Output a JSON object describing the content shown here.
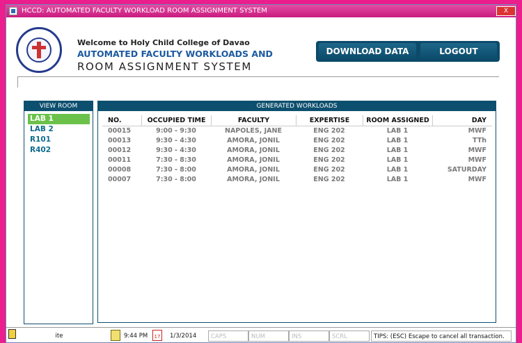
{
  "window": {
    "title": "HCCD: AUTOMATED FACULTY WORKLOAD  ROOM ASSIGNMENT SYSTEM",
    "close_label": "X"
  },
  "header": {
    "welcome": "Welcome to Holy Child College of Davao",
    "system_line1": "AUTOMATED FACULTY WORKLOADS AND",
    "system_line2": "ROOM  ASSIGNMENT  SYSTEM",
    "download_label": "DOWNLOAD DATA",
    "logout_label": "LOGOUT"
  },
  "view_room": {
    "title": "VIEW ROOM",
    "items": [
      {
        "label": "LAB 1",
        "selected": true
      },
      {
        "label": "LAB 2",
        "selected": false
      },
      {
        "label": "R101",
        "selected": false
      },
      {
        "label": "R402",
        "selected": false
      }
    ]
  },
  "workloads": {
    "title": "GENERATED WORKLOADS",
    "columns": [
      "NO.",
      "OCCUPIED TIME",
      "FACULTY",
      "EXPERTISE",
      "ROOM ASSIGNED",
      "DAY"
    ],
    "rows": [
      [
        "00015",
        "9:00 - 9:30",
        "NAPOLES, JANE",
        "ENG 202",
        "LAB 1",
        "MWF"
      ],
      [
        "00013",
        "9:30 - 4:30",
        "AMORA, JONIL",
        "ENG 202",
        "LAB 1",
        "TTh"
      ],
      [
        "00012",
        "9:30 - 4:30",
        "AMORA, JONIL",
        "ENG 202",
        "LAB 1",
        "MWF"
      ],
      [
        "00011",
        "7:30 - 8:30",
        "AMORA, JONIL",
        "ENG 202",
        "LAB 1",
        "MWF"
      ],
      [
        "00008",
        "7:30 - 8:00",
        "AMORA, JONIL",
        "ENG 202",
        "LAB 1",
        "SATURDAY"
      ],
      [
        "00007",
        "7:30 - 8:00",
        "AMORA, JONIL",
        "ENG 202",
        "LAB 1",
        "MWF"
      ]
    ]
  },
  "statusbar": {
    "user": "ite",
    "time": "9:44 PM",
    "calendar_day": "17",
    "date": "1/3/2014",
    "caps": "CAPS",
    "num": "NUM",
    "ins": "INS",
    "scrl": "SCRL",
    "tips": "TIPS: (ESC) Escape to cancel all transaction."
  },
  "colors": {
    "accent": "#0d4f6e",
    "selected": "#6bc24a",
    "titlebar": "#d12a8a",
    "background": "#ec1d8c"
  }
}
